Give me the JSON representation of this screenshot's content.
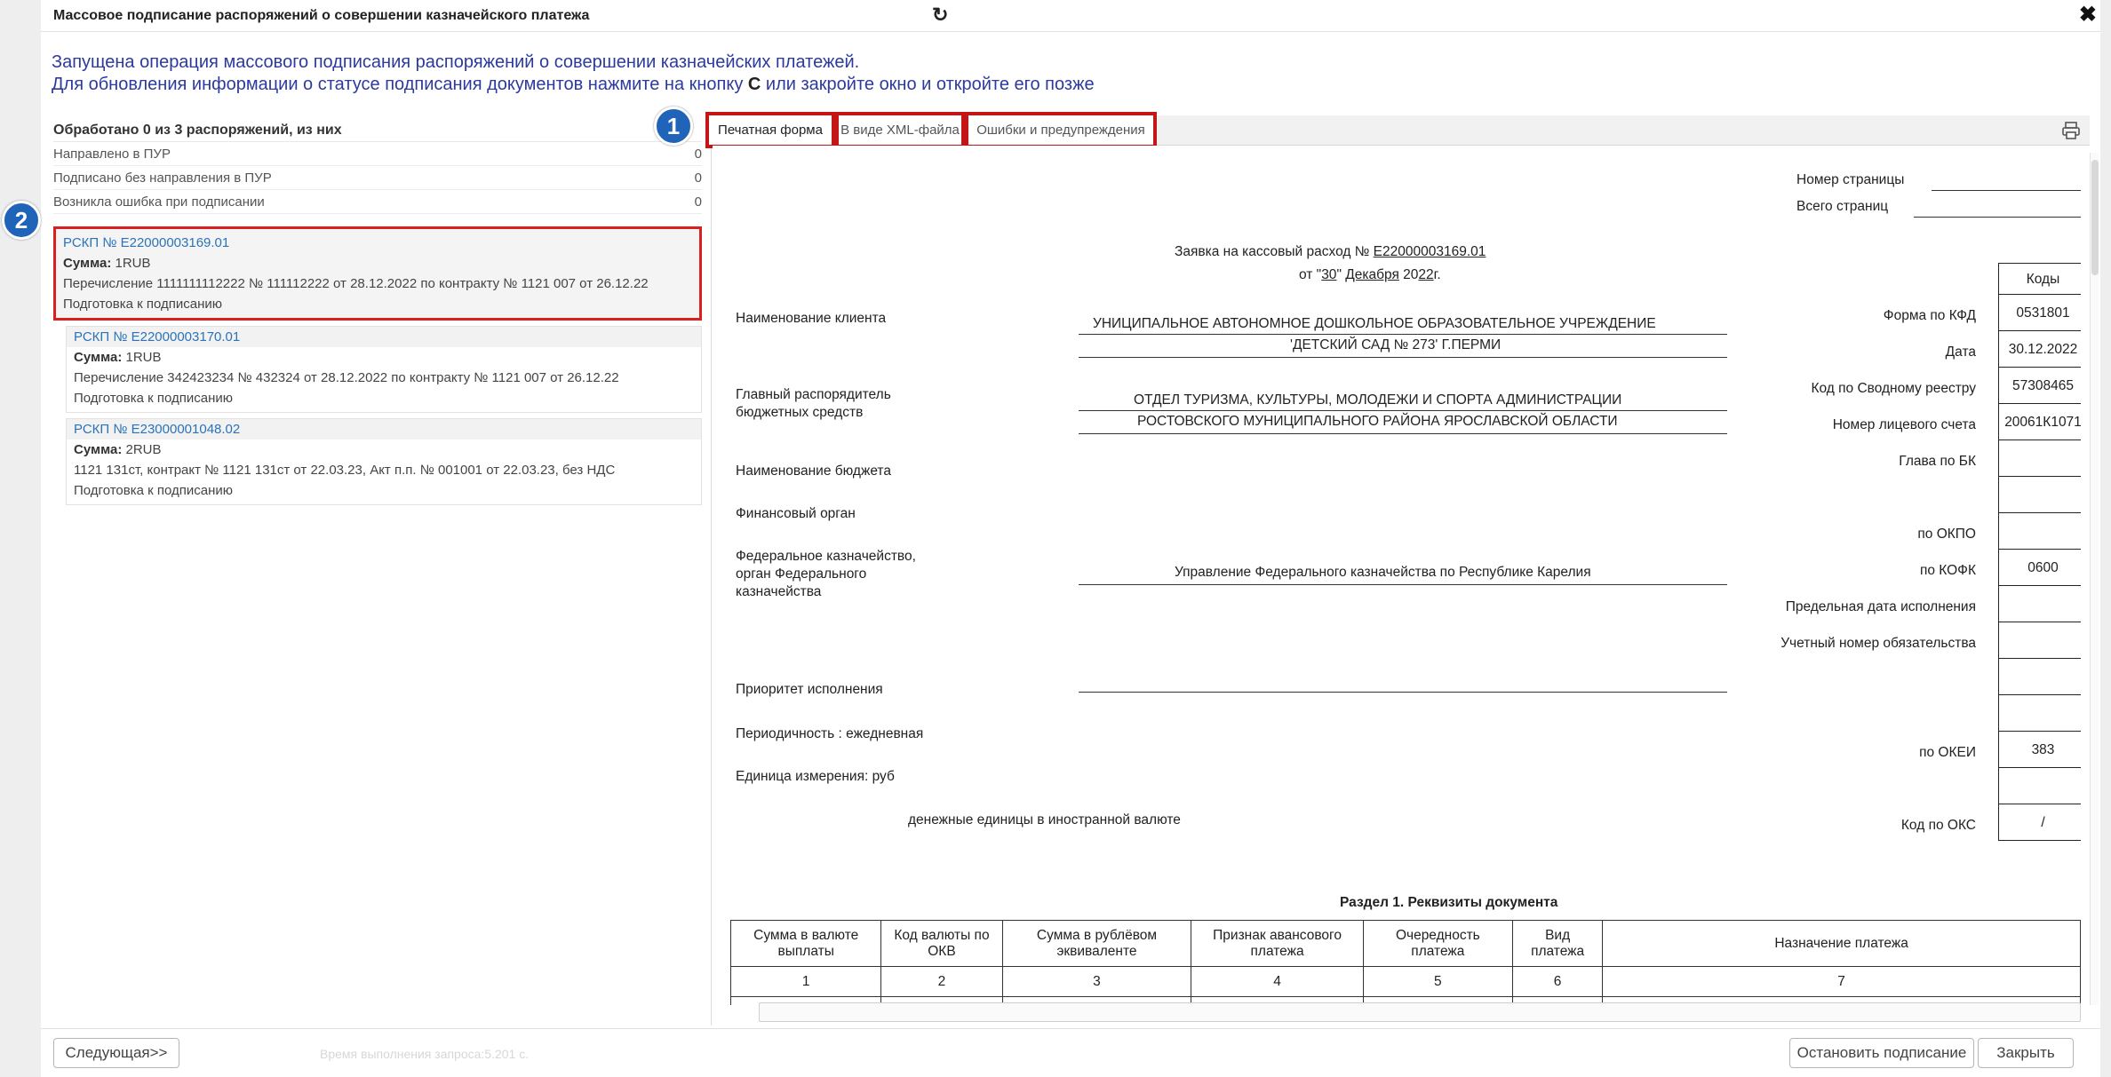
{
  "window": {
    "title": "Массовое подписание распоряжений о совершении казначейского платежа",
    "refresh_icon": "refresh-icon",
    "close_glyph": "✖"
  },
  "info": {
    "line1": "Запущена операция массового подписания распоряжений о совершении казначейских платежей.",
    "line2_before": "Для обновления информации о статусе подписания документов нажмите на кнопку ",
    "line2_icon": "C",
    "line2_after": " или закройте окно и откройте его позже"
  },
  "stats": {
    "header": "Обработано 0 из 3 распоряжений, из них",
    "rows": [
      {
        "label": "Направлено в ПУР",
        "value": "0"
      },
      {
        "label": "Подписано без направления в ПУР",
        "value": "0"
      },
      {
        "label": "Возникла ошибка при подписании",
        "value": "0"
      }
    ]
  },
  "cards": [
    {
      "number": "РСКП № Е22000003169.01",
      "sum_label": "Сумма:",
      "sum": "1RUB",
      "desc": "Перечисление 1111111112222 № 111112222 от 28.12.2022 по контракту № 1121 007 от 26.12.22",
      "status": "Подготовка к подписанию"
    },
    {
      "number": "РСКП № Е22000003170.01",
      "sum_label": "Сумма:",
      "sum": "1RUB",
      "desc": "Перечисление 342423234 № 432324 от 28.12.2022 по контракту № 1121 007 от 26.12.22",
      "status": "Подготовка к подписанию"
    },
    {
      "number": "РСКП № Е23000001048.02",
      "sum_label": "Сумма:",
      "sum": "2RUB",
      "desc": "1121 131ст, контракт № 1121 131ст от 22.03.23, Акт п.п. № 001001 от 22.03.23, без НДС",
      "status": "Подготовка к подписанию"
    }
  ],
  "markers": {
    "m1": "1",
    "m2": "2"
  },
  "tabs": [
    {
      "label": "Печатная форма",
      "active": true
    },
    {
      "label": "В виде XML-файла",
      "active": false
    },
    {
      "label": "Ошибки и предупреждения",
      "active": false
    }
  ],
  "print_icon": "printer-icon",
  "document": {
    "page_no_label": "Номер страницы",
    "pages_total_label": "Всего страниц",
    "title_prefix": "Заявка на кассовый расход №",
    "title_number": "Е22000003169.01",
    "date_ot": "от \"",
    "date_day": "30",
    "date_quote": "\"",
    "date_month": "Декабря",
    "date_year_prefix": "20",
    "date_year": "22",
    "date_g": "г.",
    "client_label": "Наименование клиента",
    "client_line1": "УНИЦИПАЛЬНОЕ АВТОНОМНОЕ ДОШКОЛЬНОЕ ОБРАЗОВАТЕЛЬНОЕ УЧРЕЖДЕНИЕ",
    "client_line2": "'ДЕТСКИЙ САД № 273' Г.ПЕРМИ",
    "manager_label1": "Главный распорядитель",
    "manager_label2": "бюджетных средств",
    "manager_line1": "ОТДЕЛ ТУРИЗМА, КУЛЬТУРЫ, МОЛОДЕЖИ И СПОРТА АДМИНИСТРАЦИИ",
    "manager_line2": "РОСТОВСКОГО МУНИЦИПАЛЬНОГО РАЙОНА ЯРОСЛАВСКОЙ ОБЛАСТИ",
    "budget_label": "Наименование бюджета",
    "fin_label": "Финансовый орган",
    "fk_label1": "Федеральное казначейство,",
    "fk_label2": "орган Федерального",
    "fk_label3": "казначейства",
    "fk_value": "Управление Федерального казначейства по Республике Карелия",
    "priority_label": "Приоритет исполнения",
    "period_label": "Периодичность : ежедневная",
    "unit_label": "Единица измерения: руб",
    "currency_label": "денежные единицы в иностранной валюте",
    "codes_header": "Коды",
    "codes": [
      {
        "label": "Форма по КФД",
        "value": "0531801"
      },
      {
        "label": "Дата",
        "value": "30.12.2022"
      },
      {
        "label": "Код по Сводному реестру",
        "value": "57308465"
      },
      {
        "label": "Номер лицевого счета",
        "value": "20061К1071"
      },
      {
        "label": "Глава по БК",
        "value": ""
      },
      {
        "label": "",
        "value": ""
      },
      {
        "label": "по ОКПО",
        "value": ""
      },
      {
        "label": "по КОФК",
        "value": "0600"
      },
      {
        "label": "Предельная дата исполнения",
        "value": ""
      },
      {
        "label": "Учетный номер обязательства",
        "value": ""
      },
      {
        "label": "",
        "value": ""
      },
      {
        "label": "",
        "value": ""
      },
      {
        "label": "по ОКЕИ",
        "value": "383"
      },
      {
        "label": "",
        "value": ""
      },
      {
        "label": "Код по ОКС",
        "value": "/"
      }
    ],
    "section_title": "Раздел 1. Реквизиты документа",
    "table_headers": [
      "Сумма в валюте выплаты",
      "Код валюты по ОКВ",
      "Сумма в рублёвом эквиваленте",
      "Признак авансового платежа",
      "Очередность платежа",
      "Вид платежа",
      "Назначение платежа"
    ],
    "table_numbers": [
      "1",
      "2",
      "3",
      "4",
      "5",
      "6",
      "7"
    ]
  },
  "footer": {
    "next_button": "Следующая>>",
    "timing": "Время выполнения запроса:5.201 с.",
    "stop_button": "Остановить подписание",
    "close_button": "Закрыть"
  }
}
